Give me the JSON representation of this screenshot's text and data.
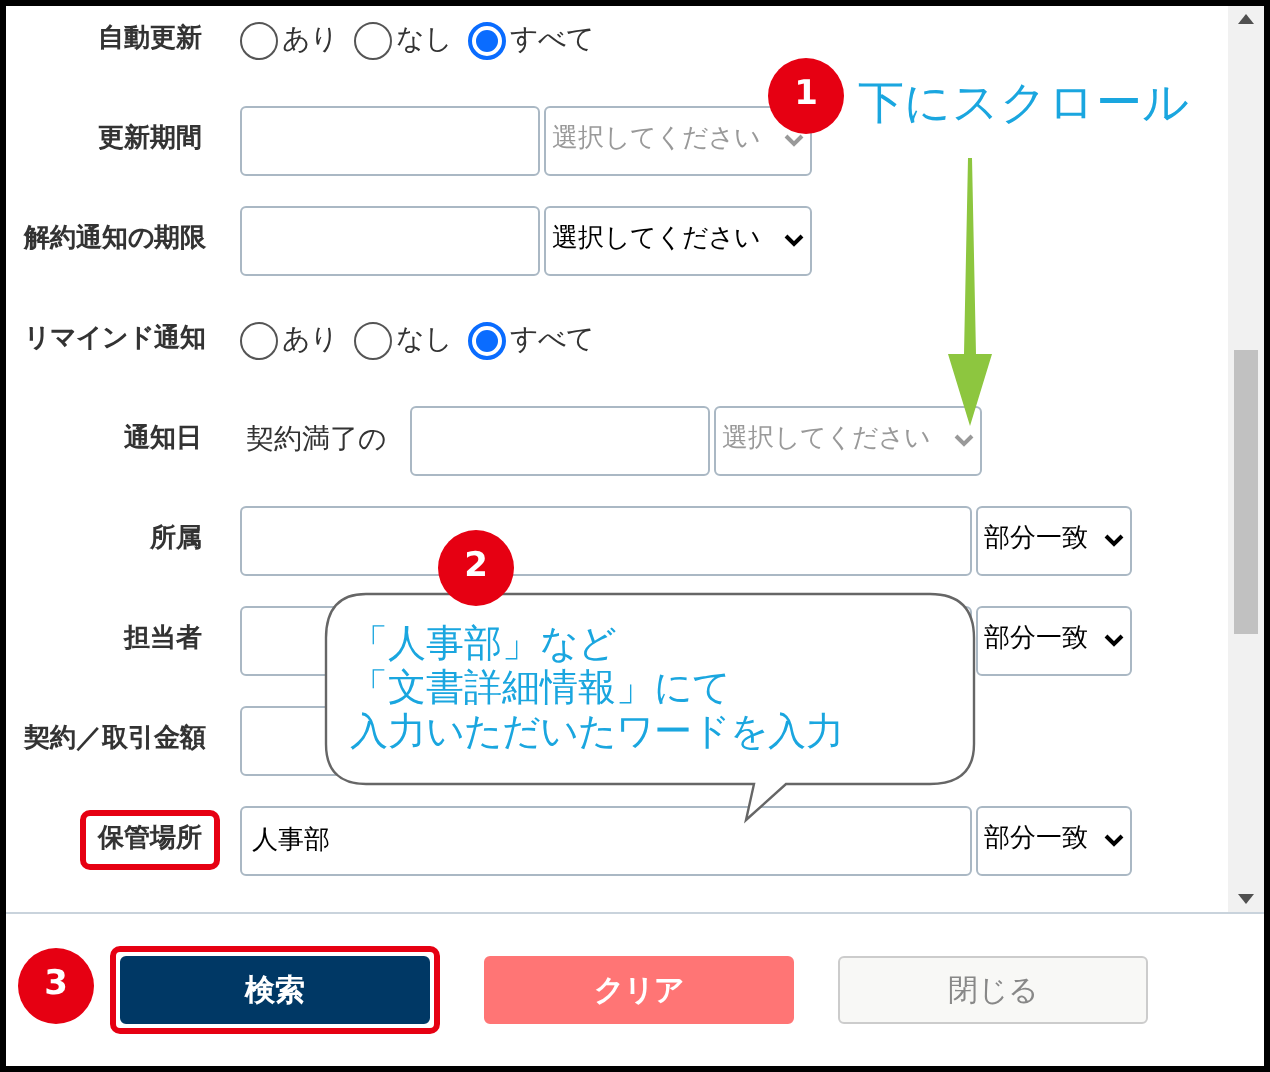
{
  "form_rows": [
    {
      "label": "自動更新",
      "kind": "radio",
      "highlighted": false,
      "options": [
        {
          "label": "あり",
          "selected": false
        },
        {
          "label": "なし",
          "selected": false
        },
        {
          "label": "すべて",
          "selected": true
        }
      ]
    },
    {
      "label": "更新期間",
      "kind": "range",
      "highlighted": false,
      "select": {
        "text": "選択してください",
        "disabled": true
      }
    },
    {
      "label": "解約通知の期限",
      "kind": "range",
      "highlighted": false,
      "select": {
        "text": "選択してください",
        "disabled": false
      }
    },
    {
      "label": "リマインド通知",
      "kind": "radio",
      "highlighted": false,
      "options": [
        {
          "label": "あり",
          "selected": false
        },
        {
          "label": "なし",
          "selected": false
        },
        {
          "label": "すべて",
          "selected": true
        }
      ]
    },
    {
      "label": "通知日",
      "kind": "range",
      "prefix": "契約満了の",
      "highlighted": false,
      "select": {
        "text": "選択してください",
        "disabled": true
      }
    },
    {
      "label": "所属",
      "kind": "match",
      "highlighted": false,
      "select": {
        "text": "部分一致",
        "disabled": false
      }
    },
    {
      "label": "担当者",
      "kind": "match",
      "highlighted": false,
      "select": {
        "text": "部分一致",
        "disabled": false
      }
    },
    {
      "label": "契約／取引金額",
      "kind": "amount",
      "highlighted": false
    },
    {
      "label": "保管場所",
      "kind": "match",
      "value": "人事部",
      "highlighted": true,
      "select": {
        "text": "部分一致",
        "disabled": false
      }
    }
  ],
  "buttons": [
    {
      "label": "検索",
      "kind": "primary",
      "highlighted": true
    },
    {
      "label": "クリア",
      "kind": "danger",
      "highlighted": false
    },
    {
      "label": "閉じる",
      "kind": "secondary",
      "highlighted": false
    }
  ],
  "annotations": [
    {
      "kind": "scroll_hint",
      "number": "1",
      "text": "下にスクロール"
    },
    {
      "kind": "bubble",
      "number": "2",
      "lines": [
        "「人事部」など",
        "「文書詳細情報」にて",
        "入力いただいたワードを入力"
      ]
    },
    {
      "kind": "step",
      "number": "3"
    }
  ]
}
